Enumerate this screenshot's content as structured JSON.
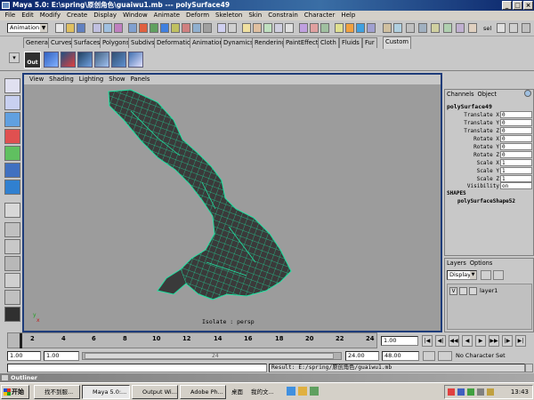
{
  "window": {
    "title": "Maya 5.0: E:\\spring\\原创角色\\guaiwu1.mb  ---  polySurface49",
    "buttons": [
      "_",
      "□",
      "×"
    ]
  },
  "menubar": [
    "File",
    "Edit",
    "Modify",
    "Create",
    "Display",
    "Window",
    "Animate",
    "Deform",
    "Skeleton",
    "Skin",
    "Constrain",
    "Character",
    "Help"
  ],
  "mode_selector": "Animation",
  "toolbar": {
    "sel_label": "sel"
  },
  "shelf_tabs": [
    "General",
    "Curves",
    "Surfaces",
    "Polygons",
    "Subdivs",
    "Deformation",
    "Animation",
    "Dynamics",
    "Rendering",
    "PaintEffects",
    "Cloth",
    "Fluids",
    "Fur",
    "Custom"
  ],
  "shelf_active_tab": "Custom",
  "shelf": {
    "out_label": "Out"
  },
  "panel_menu": [
    "View",
    "Shading",
    "Lighting",
    "Show",
    "Panels"
  ],
  "viewport": {
    "label": "Isolate : persp",
    "axis_x": "x",
    "axis_y": "y"
  },
  "channel_box": {
    "menu": [
      "Channels",
      "Object"
    ],
    "object_name": "polySurface49",
    "attributes": [
      {
        "name": "Translate X",
        "value": "0"
      },
      {
        "name": "Translate Y",
        "value": "0"
      },
      {
        "name": "Translate Z",
        "value": "0"
      },
      {
        "name": "Rotate X",
        "value": "0"
      },
      {
        "name": "Rotate Y",
        "value": "0"
      },
      {
        "name": "Rotate Z",
        "value": "0"
      },
      {
        "name": "Scale X",
        "value": "1"
      },
      {
        "name": "Scale Y",
        "value": "1"
      },
      {
        "name": "Scale Z",
        "value": "1"
      },
      {
        "name": "Visibility",
        "value": "on"
      }
    ],
    "shapes_label": "SHAPES",
    "shape_name": "polySurfaceShape52"
  },
  "layer_editor": {
    "menu": [
      "Layers",
      "Options"
    ],
    "dropdown": "Display",
    "layers": [
      {
        "visible": "V",
        "name": "layer1"
      }
    ]
  },
  "time_slider": {
    "ticks": [
      "2",
      "4",
      "6",
      "8",
      "10",
      "12",
      "14",
      "16",
      "18",
      "20",
      "22",
      "24"
    ],
    "current_frame": "1.00",
    "play_buttons": [
      "|◀",
      "◀|",
      "◀◀",
      "◀",
      "▶",
      "▶▶",
      "|▶",
      "▶|"
    ]
  },
  "range_slider": {
    "start": "1.00",
    "start2": "1.00",
    "range_mid": "24",
    "end": "24.00",
    "end2": "48.00",
    "character_set": "No Character Set"
  },
  "command_line": {
    "result": "Result: E:/spring/原创角色/guaiwu1.mb"
  },
  "outliner_title": "Outliner",
  "taskbar": {
    "start": "开始",
    "items": [
      "找不到服...",
      "Maya 5.0:...",
      "Output Wi...",
      "Adobe Ph...",
      "桌面",
      "我的文..."
    ],
    "clock": "13:43"
  }
}
